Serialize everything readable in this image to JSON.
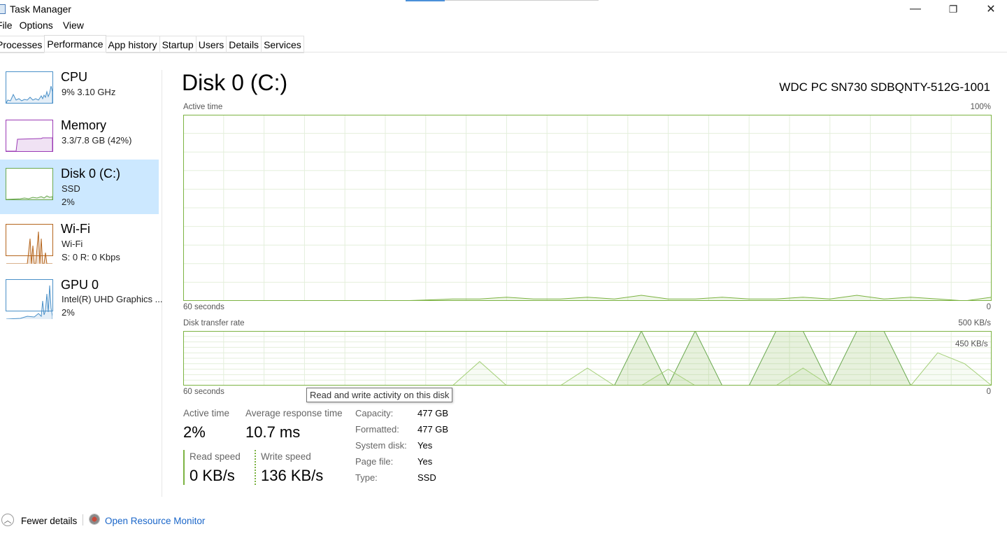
{
  "window": {
    "title": "Task Manager",
    "controls": {
      "minimize": "—",
      "restore": "❐",
      "close": "✕"
    }
  },
  "menu": [
    "File",
    "Options",
    "View"
  ],
  "tabs": [
    "Processes",
    "Performance",
    "App history",
    "Startup",
    "Users",
    "Details",
    "Services"
  ],
  "active_tab": "Performance",
  "sidebar": {
    "items": [
      {
        "name": "CPU",
        "line1": "9%  3.10 GHz",
        "line2": "",
        "color": "#4a90c8"
      },
      {
        "name": "Memory",
        "line1": "3.3/7.8 GB (42%)",
        "line2": "",
        "color": "#9b3ab5"
      },
      {
        "name": "Disk 0 (C:)",
        "line1": "SSD",
        "line2": "2%",
        "color": "#6aa84f",
        "selected": true
      },
      {
        "name": "Wi-Fi",
        "line1": "Wi-Fi",
        "line2": "S: 0  R: 0 Kbps",
        "color": "#b5651d"
      },
      {
        "name": "GPU 0",
        "line1": "Intel(R) UHD Graphics ...",
        "line2": "2%",
        "color": "#4a90c8"
      }
    ]
  },
  "main": {
    "title": "Disk 0 (C:)",
    "model": "WDC PC SN730 SDBQNTY-512G-1001",
    "active_time_chart": {
      "label": "Active time",
      "max_label": "100%",
      "x_left_label": "60 seconds",
      "x_right_label": "0"
    },
    "transfer_chart": {
      "label": "Disk transfer rate",
      "max_label": "500 KB/s",
      "inner_label": "450 KB/s",
      "x_left_label": "60 seconds",
      "x_right_label": "0"
    },
    "tooltip": "Read and write activity on this disk",
    "stats": {
      "active_time_label": "Active time",
      "active_time_value": "2%",
      "avg_response_label": "Average response time",
      "avg_response_value": "10.7 ms",
      "read_speed_label": "Read speed",
      "read_speed_value": "0 KB/s",
      "write_speed_label": "Write speed",
      "write_speed_value": "136 KB/s"
    },
    "properties": [
      {
        "label": "Capacity:",
        "value": "477 GB"
      },
      {
        "label": "Formatted:",
        "value": "477 GB"
      },
      {
        "label": "System disk:",
        "value": "Yes"
      },
      {
        "label": "Page file:",
        "value": "Yes"
      },
      {
        "label": "Type:",
        "value": "SSD"
      }
    ]
  },
  "footer": {
    "fewer_details": "Fewer details",
    "open_resource_monitor": "Open Resource Monitor"
  },
  "chart_data": [
    {
      "type": "area",
      "title": "Active time",
      "ylabel": "%",
      "ylim": [
        0,
        100
      ],
      "x": [
        60,
        58,
        56,
        54,
        52,
        50,
        48,
        46,
        44,
        42,
        40,
        38,
        36,
        34,
        32,
        30,
        28,
        26,
        24,
        22,
        20,
        18,
        16,
        14,
        12,
        10,
        8,
        6,
        4,
        2,
        0
      ],
      "series": [
        {
          "values": [
            0,
            0,
            0,
            0,
            0,
            0,
            0,
            0,
            0,
            0.5,
            1,
            1,
            2,
            1,
            1,
            2,
            1,
            3,
            1,
            1,
            2,
            1,
            1,
            2,
            1,
            3,
            1,
            2,
            1,
            0,
            2
          ]
        }
      ]
    },
    {
      "type": "area",
      "title": "Disk transfer rate",
      "ylabel": "KB/s",
      "ylim": [
        0,
        500
      ],
      "x": [
        60,
        58,
        56,
        54,
        52,
        50,
        48,
        46,
        44,
        42,
        40,
        38,
        36,
        34,
        32,
        30,
        28,
        26,
        24,
        22,
        20,
        18,
        16,
        14,
        12,
        10,
        8,
        6,
        4,
        2,
        0
      ],
      "series": [
        {
          "name": "Read",
          "values": [
            0,
            0,
            0,
            0,
            0,
            0,
            0,
            0,
            0,
            0,
            0,
            0,
            0,
            0,
            0,
            0,
            0,
            500,
            0,
            500,
            0,
            0,
            500,
            500,
            0,
            500,
            500,
            0,
            0,
            0,
            0
          ]
        },
        {
          "name": "Write",
          "values": [
            0,
            0,
            0,
            0,
            0,
            0,
            0,
            0,
            0,
            0,
            0,
            220,
            0,
            0,
            0,
            160,
            0,
            0,
            150,
            0,
            0,
            0,
            0,
            160,
            0,
            0,
            0,
            0,
            300,
            200,
            0
          ]
        }
      ]
    }
  ]
}
